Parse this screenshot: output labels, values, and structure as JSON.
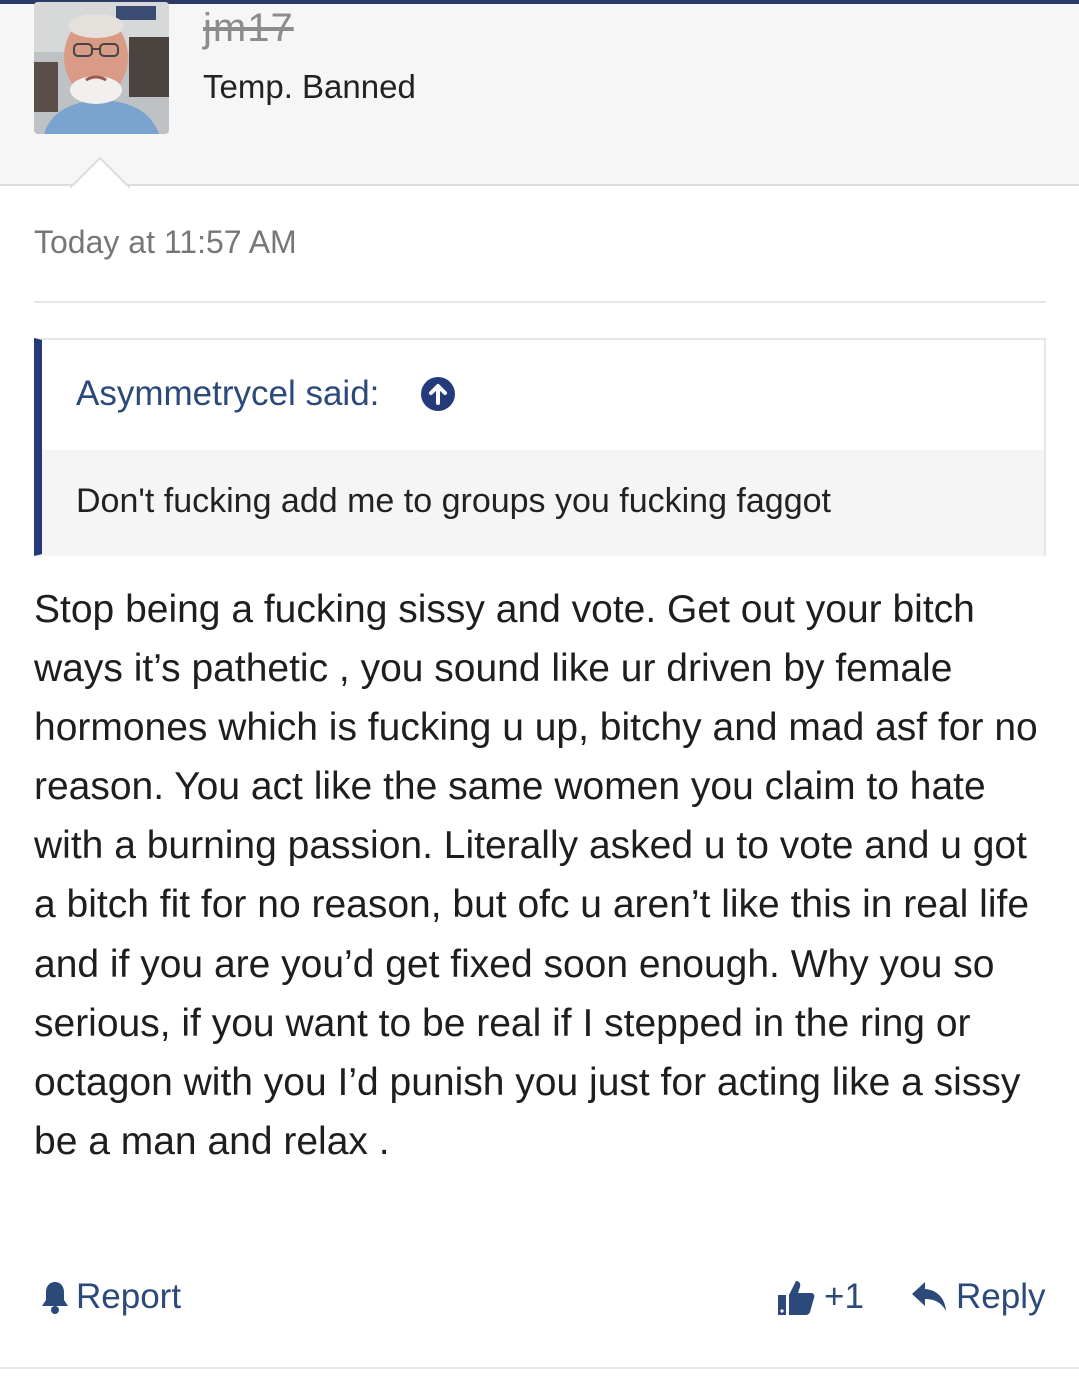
{
  "user": {
    "name": "jm17",
    "title": "Temp. Banned"
  },
  "post": {
    "timestamp": "Today at 11:57 AM",
    "quote": {
      "author_line": "Asymmetrycel said:",
      "text": "Don't fucking add me to groups you fucking faggot"
    },
    "body": "Stop being a fucking sissy and vote. Get out your bitch ways it’s pathetic , you sound like ur driven by female hormones which is fucking u up, bitchy and mad asf for no reason. You act like the same women you claim to hate with a burning passion. Literally asked u to vote and u got a bitch fit for no reason, but ofc u aren’t like this in real life and if you are you’d get fixed soon enough. Why you so serious, if you want to be real if I stepped in the ring or octagon with you I’d punish you just for acting like a sissy be a man and relax ."
  },
  "actions": {
    "report_label": "Report",
    "like_label": "+1",
    "reply_label": "Reply"
  },
  "colors": {
    "accent": "#2b4a7a",
    "quote_bar": "#243a7a",
    "header_bg": "#f6f6f6"
  },
  "icons": {
    "report": "bell-icon",
    "like": "thumbs-up-icon",
    "reply": "reply-arrow-icon",
    "quote_jump": "arrow-up-circle-icon"
  }
}
